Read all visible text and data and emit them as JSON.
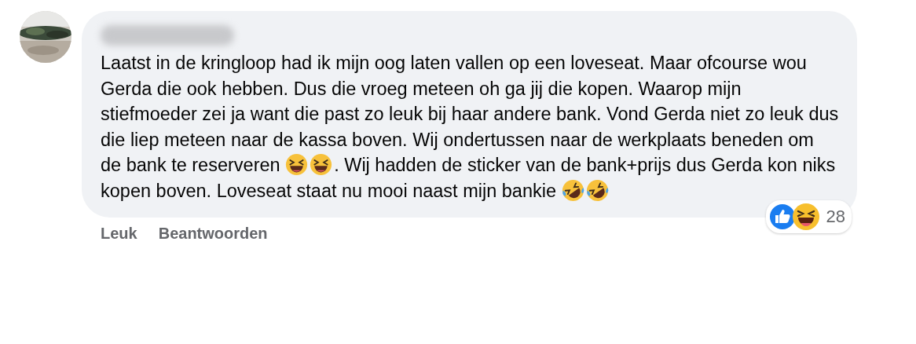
{
  "comment": {
    "body": [
      {
        "kind": "text",
        "text": "Laatst in de kringloop had ik mijn oog laten vallen op een loveseat. Maar ofcourse wou Gerda die ook hebben. Dus die vroeg meteen oh ga jij die kopen. Waarop mijn stiefmoeder zei ja want die past zo leuk bij haar andere bank. Vond Gerda niet zo leuk dus die liep meteen naar de kassa boven. Wij ondertussen naar de werkplaats beneden om de bank te reserveren "
      },
      {
        "kind": "laugh"
      },
      {
        "kind": "laugh"
      },
      {
        "kind": "text",
        "text": ". Wij hadden de sticker van de bank+prijs dus Gerda kon niks kopen boven. Loveseat staat nu mooi naast mijn bankie "
      },
      {
        "kind": "rofl"
      },
      {
        "kind": "rofl"
      }
    ],
    "reactions": {
      "types": [
        {
          "kind": "like"
        },
        {
          "kind": "laugh"
        }
      ],
      "count": "28"
    },
    "actions": [
      "Leuk",
      "Beantwoorden"
    ]
  }
}
